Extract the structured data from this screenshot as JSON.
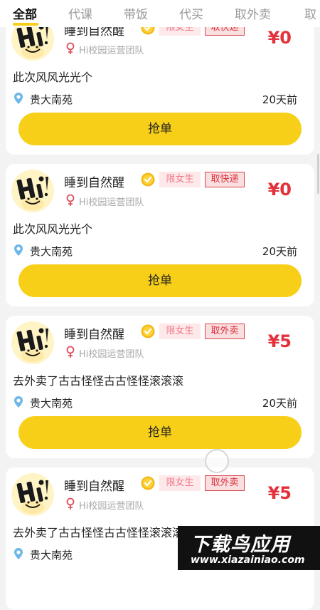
{
  "tabs": [
    {
      "label": "全部",
      "active": true
    },
    {
      "label": "代课",
      "active": false
    },
    {
      "label": "带饭",
      "active": false
    },
    {
      "label": "代买",
      "active": false
    },
    {
      "label": "取外卖",
      "active": false
    },
    {
      "label": "取",
      "active": false
    }
  ],
  "colors": {
    "accent": "#f7cf19",
    "price": "#e4323c",
    "tag_bg": "#f9dfe0",
    "gender_tag_text": "#f27a8a"
  },
  "icons": {
    "verified": "verified-badge-icon",
    "gender": "female-icon",
    "location": "location-pin-icon"
  },
  "orders": [
    {
      "name": "睡到自然醒",
      "gender_tag": "限女生",
      "type_tag": "取快递",
      "price": "¥0",
      "team": "Hi校园运营团队",
      "content": "此次风风光光个",
      "location": "贵大南苑",
      "time": "20天前",
      "button": "抢单"
    },
    {
      "name": "睡到自然醒",
      "gender_tag": "限女生",
      "type_tag": "取快递",
      "price": "¥0",
      "team": "Hi校园运营团队",
      "content": "此次风风光光个",
      "location": "贵大南苑",
      "time": "20天前",
      "button": "抢单"
    },
    {
      "name": "睡到自然醒",
      "gender_tag": "限女生",
      "type_tag": "取外卖",
      "price": "¥5",
      "team": "Hi校园运营团队",
      "content": "去外卖了古古怪怪古古怪怪滚滚滚",
      "location": "贵大南苑",
      "time": "20天前",
      "button": "抢单"
    },
    {
      "name": "睡到自然醒",
      "gender_tag": "限女生",
      "type_tag": "取外卖",
      "price": "¥5",
      "team": "Hi校园运营团队",
      "content": "去外卖了古古怪怪古古怪怪滚滚滚",
      "location": "贵大南苑",
      "time": "",
      "button": ""
    }
  ],
  "watermark": {
    "title": "下载鸟应用",
    "url": "www.xiazainiao.com"
  }
}
